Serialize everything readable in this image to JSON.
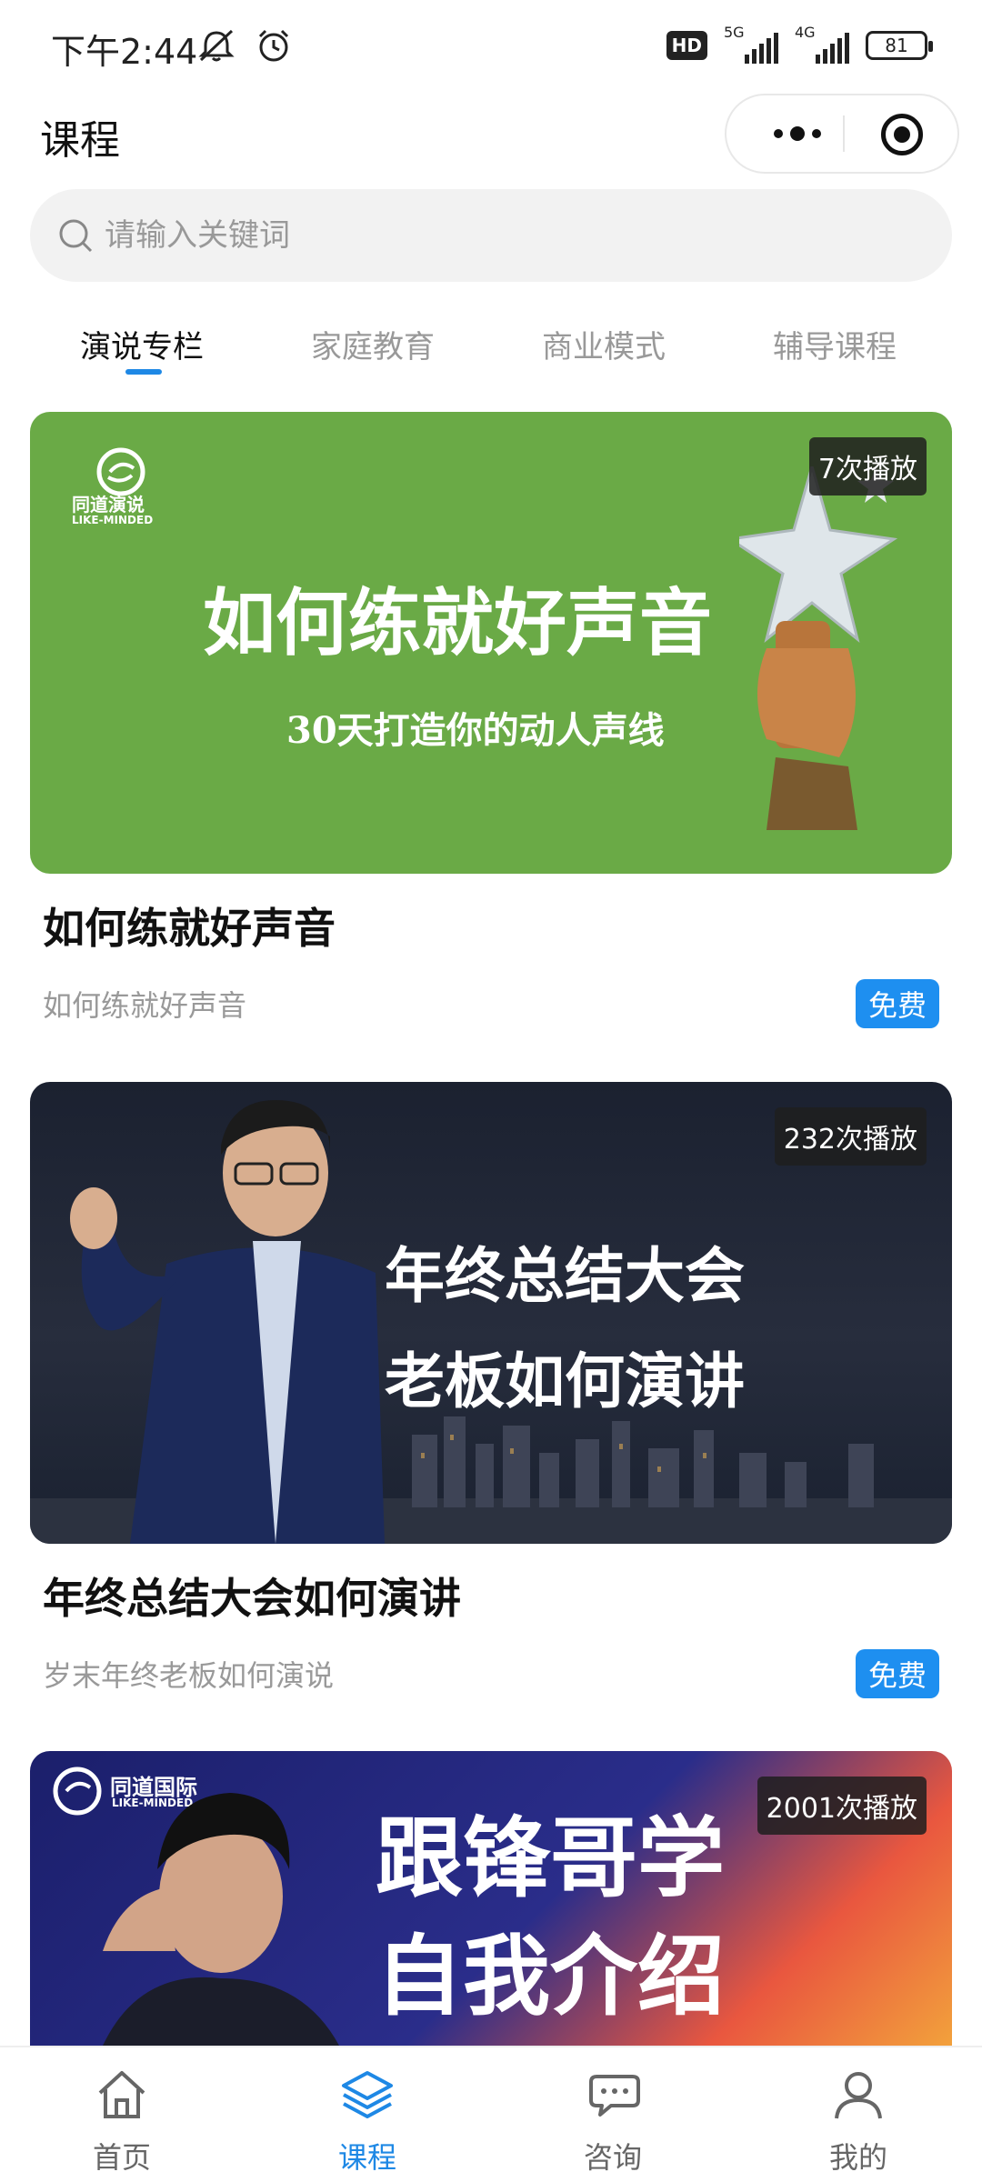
{
  "status_bar": {
    "time": "下午2:44",
    "hd": "HD",
    "net1": "5G",
    "net2": "4G",
    "battery": "81"
  },
  "header": {
    "title": "课程"
  },
  "search": {
    "placeholder": "请输入关键词"
  },
  "tabs": [
    {
      "label": "演说专栏",
      "active": true
    },
    {
      "label": "家庭教育",
      "active": false
    },
    {
      "label": "商业模式",
      "active": false
    },
    {
      "label": "辅导课程",
      "active": false
    }
  ],
  "courses": [
    {
      "plays": "7次播放",
      "thumb_line1": "如何练就好声音",
      "thumb_line2": "30天打造你的动人声线",
      "brand": "同道演说",
      "brand_en": "LIKE-MINDED",
      "title": "如何练就好声音",
      "subtitle": "如何练就好声音",
      "price": "免费",
      "bg": "#6aaa46"
    },
    {
      "plays": "232次播放",
      "thumb_line1": "年终总结大会",
      "thumb_line2": "老板如何演讲",
      "title": "年终总结大会如何演讲",
      "subtitle": "岁末年终老板如何演说",
      "price": "免费",
      "bg": "#1d2230"
    },
    {
      "plays": "2001次播放",
      "thumb_line1": "跟锋哥学",
      "thumb_line2": "自我介绍",
      "brand": "同道国际",
      "brand_en": "LIKE-MINDED",
      "bg": "#1b1f6b"
    }
  ],
  "bottom_nav": [
    {
      "label": "首页",
      "icon": "home-icon",
      "active": false
    },
    {
      "label": "课程",
      "icon": "layers-icon",
      "active": true
    },
    {
      "label": "咨询",
      "icon": "chat-icon",
      "active": false
    },
    {
      "label": "我的",
      "icon": "user-icon",
      "active": false
    }
  ],
  "colors": {
    "accent": "#1e88e5",
    "badge": "#1e8ff0"
  }
}
